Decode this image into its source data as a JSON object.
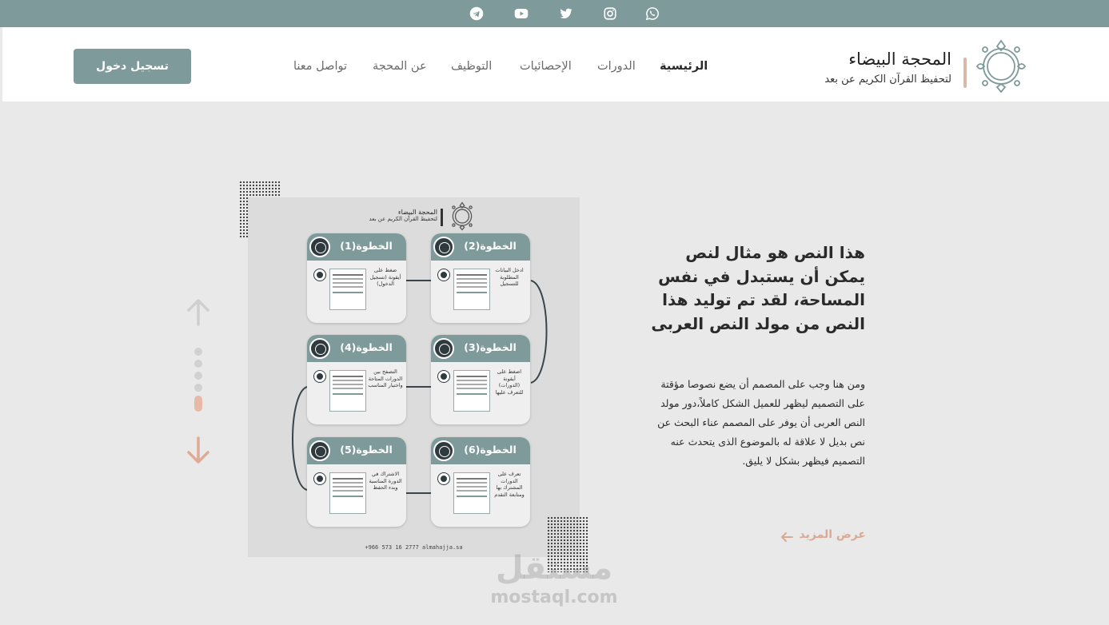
{
  "social": {
    "icons": [
      "telegram-icon",
      "youtube-icon",
      "twitter-icon",
      "instagram-icon",
      "whatsapp-icon"
    ],
    "bar_color": "#7f9a9a"
  },
  "header": {
    "brand_title": "المحجة البيضاء",
    "brand_subtitle": "لتحفيظ القرآن الكريم عن بعد",
    "nav": [
      "الرئيسية",
      "الدورات",
      "الإحصائيات",
      "التوظيف",
      "عن المحجة",
      "تواصل معنا"
    ],
    "active_nav": "الرئيسية",
    "login_label": "تسجيل دخول"
  },
  "slider": {
    "dots_total": 5,
    "active_index": 4,
    "accent_color": "#e7b9a6"
  },
  "poster": {
    "brand_title": "المحجة البيضاء",
    "brand_subtitle": "لتحفيظ القرآن الكريم عن بعد",
    "steps": [
      {
        "title": "الخطوة(1)",
        "text": "ضغط على أيقونة (تسجيل الدخول)"
      },
      {
        "title": "الخطوة(2)",
        "text": "ادخل البيانات المطلوبة للتسجيل"
      },
      {
        "title": "الخطوة(3)",
        "text": "اضغط على أيقونة (الدورات) للتعرف عليها"
      },
      {
        "title": "الخطوة(4)",
        "text": "التصفح بين الدورات المتاحة واختيار المناسب"
      },
      {
        "title": "الخطوة(5)",
        "text": "الاشتراك في الدورة المناسبة وبدء الحفظ"
      },
      {
        "title": "الخطوة(6)",
        "text": "تعرف على الدورات المشترك بها ومتابعة التقدم"
      }
    ],
    "footer": "+966 573 16 2777  almahajja.sa"
  },
  "hero": {
    "title": "هذا النص هو مثال لنص يمكن أن يستبدل في نفس المساحة، لقد تم توليد هذا النص من مولد النص العربى",
    "body": "ومن هنا وجب على المصمم أن يضع نصوصا مؤقتة على التصميم ليظهر للعميل الشكل كاملاً،دور مولد النص العربى أن يوفر على المصمم عناء البحث عن نص بديل لا علاقة له بالموضوع الذى يتحدث عنه التصميم فيظهر بشكل لا يليق.",
    "more_label": "عرض المزيد"
  },
  "watermark": {
    "ar": "مستقل",
    "en": "mostaql.com"
  }
}
